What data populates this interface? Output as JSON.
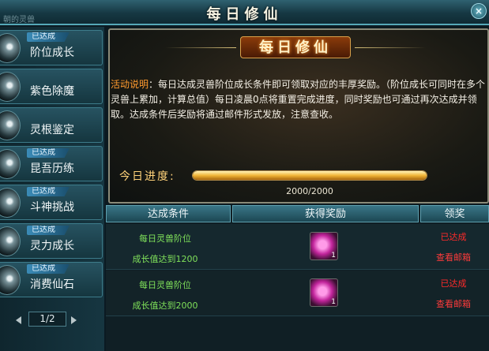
{
  "window": {
    "title": "每日修仙",
    "ghost_text": "朝的灵兽",
    "close_label": "×"
  },
  "sidebar": {
    "badge": "已达成",
    "items": [
      {
        "label": "阶位成长"
      },
      {
        "label": "紫色除魔"
      },
      {
        "label": "灵根鉴定"
      },
      {
        "label": "昆吾历练"
      },
      {
        "label": "斗神挑战"
      },
      {
        "label": "灵力成长"
      },
      {
        "label": "消费仙石"
      }
    ],
    "pager": {
      "text": "1/2"
    }
  },
  "panel": {
    "title": "每日修仙",
    "desc_key": "活动说明",
    "desc_text": "：每日达成灵兽阶位成长条件即可领取对应的丰厚奖励。（阶位成长可同时在多个灵兽上累加，计算总值）每日凌晨0点将重置完成进度，同时奖励也可通过再次达成并领取。达成条件后奖励将通过邮件形式发放，注意查收。",
    "progress_label": "今日进度:",
    "progress_text": "2000/2000",
    "progress_fraction": 1.0
  },
  "table": {
    "headers": [
      "达成条件",
      "获得奖励",
      "领奖"
    ],
    "rows": [
      {
        "cond_a": "每日灵兽阶位",
        "cond_b": "成长值达到1200",
        "qty": "1",
        "status": "已达成",
        "mail": "查看邮箱"
      },
      {
        "cond_a": "每日灵兽阶位",
        "cond_b": "成长值达到2000",
        "qty": "1",
        "status": "已达成",
        "mail": "查看邮箱"
      }
    ]
  },
  "colors": {
    "accent": "#ff9a2e",
    "cond_green": "#7fe05a",
    "status_red": "#ff2a2a"
  },
  "icons": [
    "close-icon",
    "prev-page-icon",
    "next-page-icon",
    "reward-item-icon"
  ]
}
